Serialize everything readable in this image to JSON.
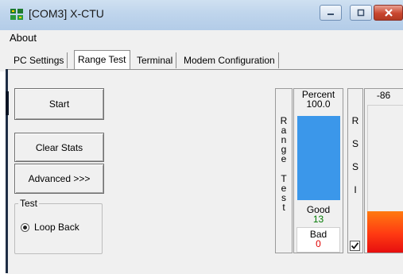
{
  "window": {
    "title": "[COM3] X-CTU",
    "icon": "xctu-app-icon",
    "controls": {
      "minimize_icon": "minimize-icon",
      "maximize_icon": "maximize-icon",
      "close_icon": "close-icon"
    }
  },
  "menu": {
    "items": [
      {
        "label": "About"
      }
    ]
  },
  "tabs": [
    {
      "label": "PC Settings",
      "active": false
    },
    {
      "label": "Range Test",
      "active": true
    },
    {
      "label": "Terminal",
      "active": false
    },
    {
      "label": "Modem Configuration",
      "active": false
    }
  ],
  "range_test": {
    "start_label": "Start",
    "clear_label": "Clear Stats",
    "advanced_label": "Advanced >>>",
    "test_group_label": "Test",
    "loop_back_label": "Loop Back",
    "loop_back_selected": true,
    "range_label_vertical": "R\na\nn\ng\ne\n \nT\ne\ns\nt",
    "percent_label": "Percent",
    "percent_value": "100.0",
    "percent_fraction": 1.0,
    "good_label": "Good",
    "good_value": "13",
    "bad_label": "Bad",
    "bad_value": "0",
    "rssi_label_vertical": "R\nS\nS\nI",
    "rssi_checked": true,
    "rssi_value": "-86",
    "rssi_fill_fraction": 0.28,
    "colors": {
      "percent_bar": "#3b97ea",
      "rssi_bar": "#ff4a12",
      "good": "#007a00",
      "bad": "#e00000"
    }
  }
}
